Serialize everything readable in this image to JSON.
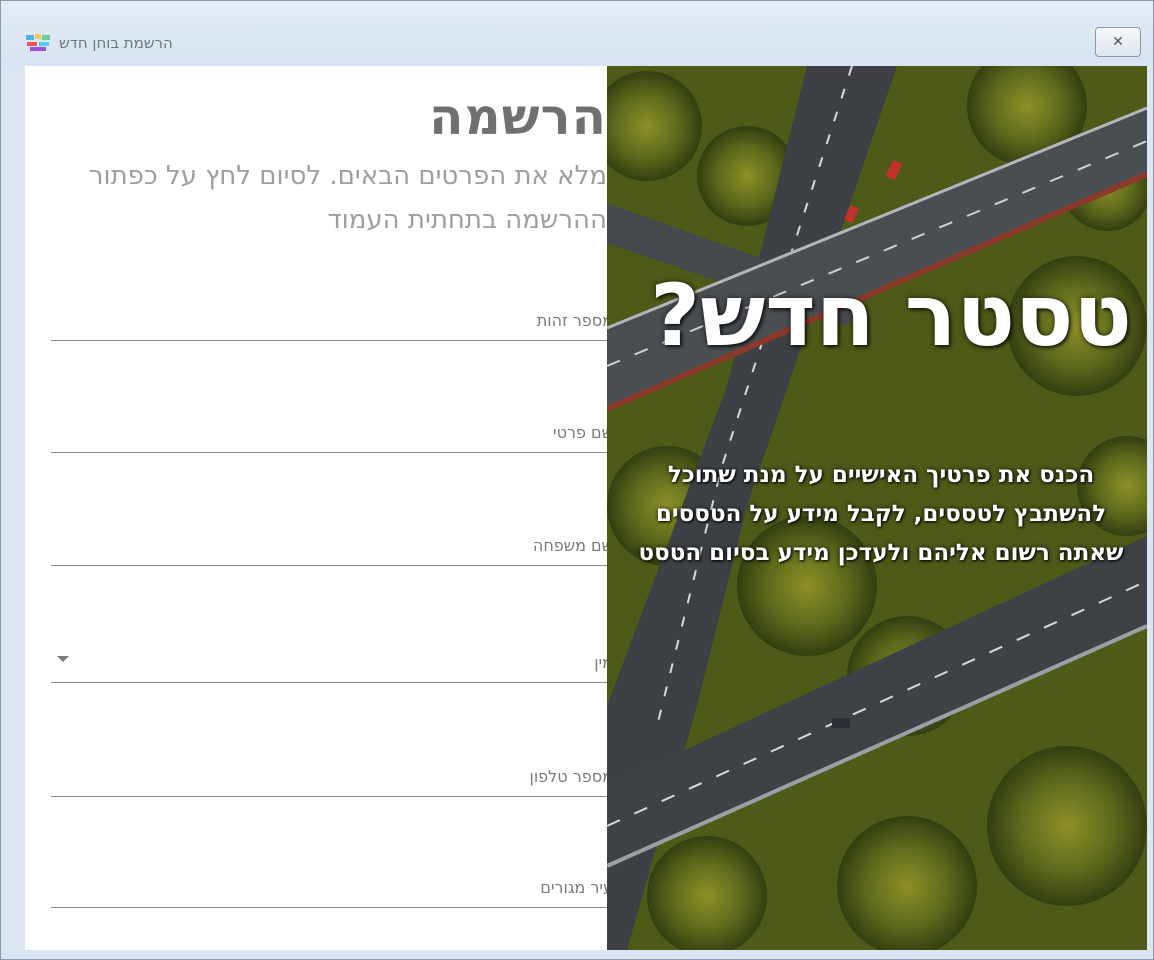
{
  "window": {
    "title": "הרשמת בוחן חדש",
    "close_glyph": "✕",
    "app_icon": "app-logo-icon"
  },
  "form": {
    "heading": "הרשמה",
    "subtitle": "מלא את הפרטים הבאים. לסיום לחץ על כפתור ההרשמה בתחתית העמוד",
    "fields": [
      {
        "label": "מספר זהות",
        "type": "text"
      },
      {
        "label": "שם פרטי",
        "type": "text"
      },
      {
        "label": "שם משפחה",
        "type": "text"
      },
      {
        "label": "מין",
        "type": "dropdown"
      },
      {
        "label": "מספר טלפון",
        "type": "text"
      },
      {
        "label": "עיר מגורים",
        "type": "text"
      }
    ]
  },
  "promo": {
    "title": "טסטר חדש?",
    "body": "הכנס את פרטיך האישיים על מנת שתוכל להשתבץ לטססים, לקבל מידע על הטססים שאתה רשום אליהם ולעדכן מידע בסיום הטסט"
  },
  "colors": {
    "accent_road": "#3f4347",
    "foliage": "#5f6b1f",
    "window_frame": "#dbe6f2"
  }
}
